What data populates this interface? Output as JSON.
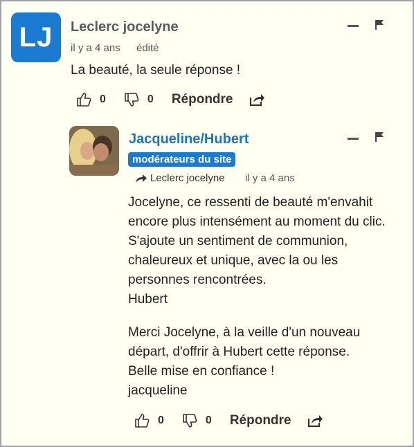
{
  "comment1": {
    "initials": "LJ",
    "author": "Leclerc jocelyne",
    "time": "il y a 4 ans",
    "edited": "édité",
    "text": "La beauté, la seule réponse !",
    "likes": "0",
    "dislikes": "0",
    "reply_label": "Répondre"
  },
  "comment2": {
    "author": "Jacqueline/Hubert",
    "badge": "modérateurs du site",
    "reply_to": "Leclerc jocelyne",
    "time": "il y a 4 ans",
    "paragraph1": [
      "Jocelyne, ce ressenti de beauté m'envahit",
      "encore plus intensément au moment du clic.",
      "S'ajoute un sentiment de communion,",
      "chaleureux et unique, avec la ou les",
      "personnes rencontrées.",
      "Hubert"
    ],
    "paragraph2": [
      "Merci Jocelyne, à la veille d'un nouveau",
      "départ, d'offrir à Hubert cette réponse.",
      "Belle mise en confiance !",
      "jacqueline"
    ],
    "likes": "0",
    "dislikes": "0",
    "reply_label": "Répondre"
  }
}
